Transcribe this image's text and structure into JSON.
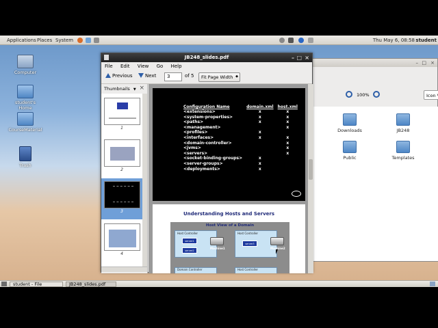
{
  "top_panel": {
    "menus": [
      "Applications",
      "Places",
      "System"
    ],
    "clock": "Thu May  6, 08:58",
    "user": "student"
  },
  "desktop_icons": [
    {
      "label": "Computer",
      "icon": "computer-icon"
    },
    {
      "label": "student's Home",
      "icon": "home-folder-icon"
    },
    {
      "label": "CourseMaterial",
      "icon": "folder-icon"
    },
    {
      "label": "Trash",
      "icon": "trash-icon"
    }
  ],
  "file_browser": {
    "zoom": "100%",
    "view_mode": "Icon View",
    "folders": [
      "Downloads",
      "JB248",
      "Public",
      "Templates"
    ]
  },
  "pdf_viewer": {
    "title": "JB248_slides.pdf",
    "menu": [
      "File",
      "Edit",
      "View",
      "Go",
      "Help"
    ],
    "toolbar": {
      "previous": "Previous",
      "next": "Next",
      "page_value": "3",
      "page_total": "of 5",
      "zoom": "Fit Page Width"
    },
    "sidebar": {
      "mode": "Thumbnails",
      "thumbnails": [
        "1",
        "2",
        "3",
        "4"
      ],
      "selected": "3"
    },
    "slide3": {
      "headers": [
        "Configuration Name",
        "domain.xml",
        "host.xml"
      ],
      "rows": [
        {
          "name": "<extensions>",
          "domain": "x",
          "host": "x"
        },
        {
          "name": "<system-properties>",
          "domain": "x",
          "host": "x"
        },
        {
          "name": "<paths>",
          "domain": "x",
          "host": "x"
        },
        {
          "name": "<management>",
          "domain": "",
          "host": "x"
        },
        {
          "name": "<profiles>",
          "domain": "x",
          "host": ""
        },
        {
          "name": "<interfaces>",
          "domain": "x",
          "host": "x"
        },
        {
          "name": "<domain-controller>",
          "domain": "",
          "host": "x"
        },
        {
          "name": "<jvms>",
          "domain": "",
          "host": "x"
        },
        {
          "name": "<servers>",
          "domain": "",
          "host": "x"
        },
        {
          "name": "<socket-binding-groups>",
          "domain": "x",
          "host": ""
        },
        {
          "name": "<server-groups>",
          "domain": "x",
          "host": ""
        },
        {
          "name": "<deployments>",
          "domain": "x",
          "host": ""
        }
      ]
    },
    "slide4": {
      "title": "Understanding Hosts and Servers",
      "diagram_title": "Host View of a Domain",
      "host_controller": "Host Controller",
      "domain_controller": "Domain Controller",
      "server1": "server1",
      "server2": "server2",
      "server3": "server3",
      "machine1": "Machine1",
      "machine2": "Machine2"
    }
  },
  "taskbar": {
    "tasks": [
      "student - File Browser",
      "JB248_slides.pdf"
    ]
  }
}
